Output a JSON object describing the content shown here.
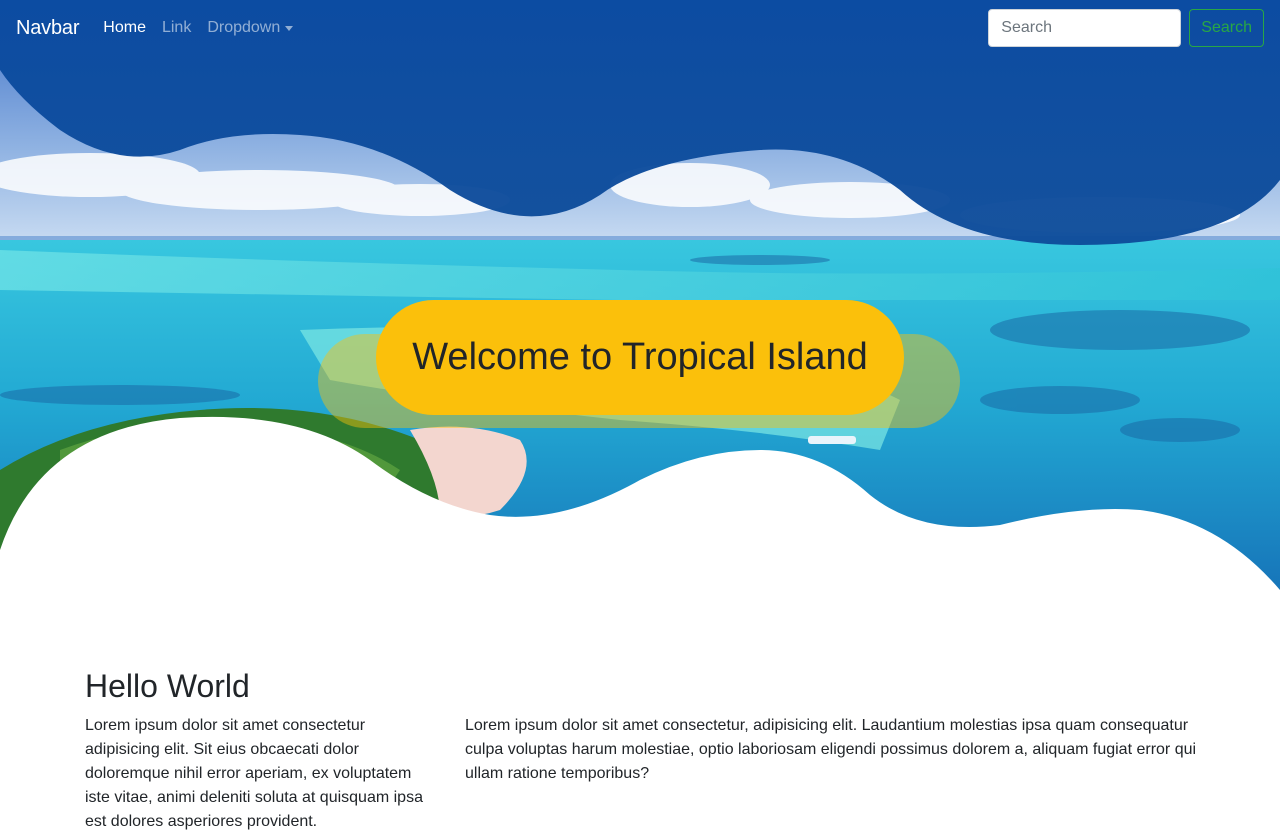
{
  "navbar": {
    "brand": "Navbar",
    "links": [
      {
        "label": "Home",
        "active": true
      },
      {
        "label": "Link",
        "active": false
      },
      {
        "label": "Dropdown",
        "active": false,
        "dropdown": true
      }
    ],
    "search": {
      "placeholder": "Search",
      "value": "",
      "button_label": "Search"
    }
  },
  "hero": {
    "title": "Welcome to Tropical Island",
    "accent_color": "#fbc00b"
  },
  "content": {
    "heading": "Hello World",
    "left_paragraph": "Lorem ipsum dolor sit amet consectetur adipisicing elit. Sit eius obcaecati dolor doloremque nihil error aperiam, ex voluptatem iste vitae, animi deleniti soluta at quisquam ipsa est dolores asperiores provident.",
    "right_paragraph": "Lorem ipsum dolor sit amet consectetur, adipisicing elit. Laudantium molestias ipsa quam consequatur culpa voluptas harum molestiae, optio laboriosam eligendi possimus dolorem a, aliquam fugiat error qui ullam ratione temporibus?"
  },
  "colors": {
    "wave_blue": "#0a4b9c",
    "success_green": "#28a745",
    "text_dark": "#212529"
  }
}
